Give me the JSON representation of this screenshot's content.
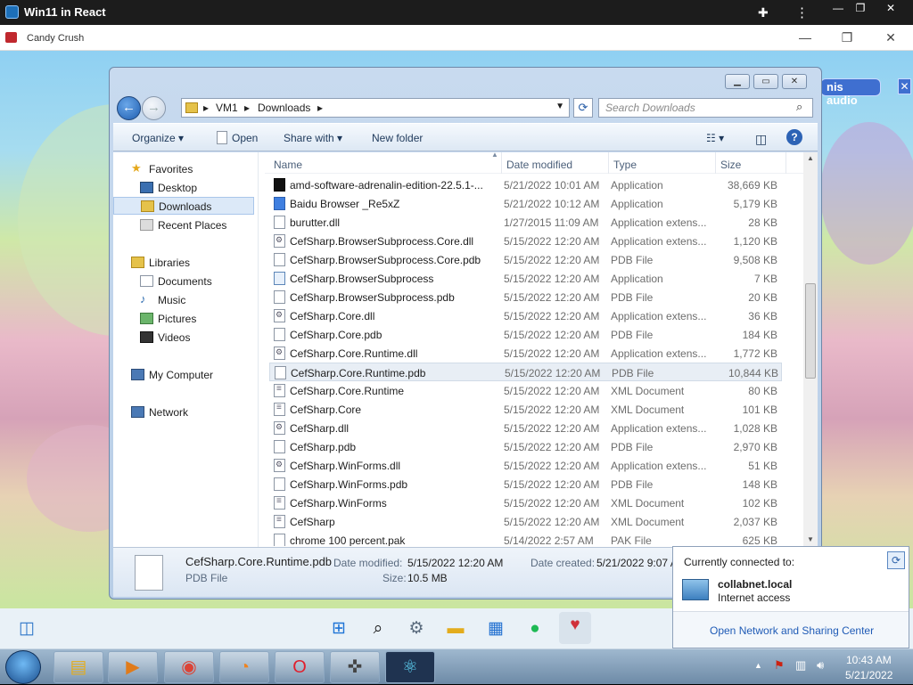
{
  "browser": {
    "title": "Win11 in React"
  },
  "game_window": {
    "title": "Candy Crush",
    "audio_badge": "nis audio"
  },
  "explorer": {
    "breadcrumb": [
      "VM1",
      "Downloads"
    ],
    "search_placeholder": "Search Downloads",
    "commands": {
      "organize": "Organize",
      "open": "Open",
      "share_with": "Share with",
      "new_folder": "New folder"
    },
    "nav": {
      "favorites": "Favorites",
      "desktop": "Desktop",
      "downloads": "Downloads",
      "recent_places": "Recent Places",
      "libraries": "Libraries",
      "documents": "Documents",
      "music": "Music",
      "pictures": "Pictures",
      "videos": "Videos",
      "my_computer": "My Computer",
      "network": "Network"
    },
    "columns": {
      "name": "Name",
      "date": "Date modified",
      "type": "Type",
      "size": "Size"
    },
    "files": [
      {
        "name": "amd-software-adrenalin-edition-22.5.1-...",
        "date": "5/21/2022 10:01 AM",
        "type": "Application",
        "size": "38,669 KB",
        "icon": "amd"
      },
      {
        "name": "Baidu Browser _Re5xZ",
        "date": "5/21/2022 10:12 AM",
        "type": "Application",
        "size": "5,179 KB",
        "icon": "baidu"
      },
      {
        "name": "burutter.dll",
        "date": "1/27/2015 11:09 AM",
        "type": "Application extens...",
        "size": "28 KB",
        "icon": "file"
      },
      {
        "name": "CefSharp.BrowserSubprocess.Core.dll",
        "date": "5/15/2022 12:20 AM",
        "type": "Application extens...",
        "size": "1,120 KB",
        "icon": "dll"
      },
      {
        "name": "CefSharp.BrowserSubprocess.Core.pdb",
        "date": "5/15/2022 12:20 AM",
        "type": "PDB File",
        "size": "9,508 KB",
        "icon": "file"
      },
      {
        "name": "CefSharp.BrowserSubprocess",
        "date": "5/15/2022 12:20 AM",
        "type": "Application",
        "size": "7 KB",
        "icon": "app"
      },
      {
        "name": "CefSharp.BrowserSubprocess.pdb",
        "date": "5/15/2022 12:20 AM",
        "type": "PDB File",
        "size": "20 KB",
        "icon": "file"
      },
      {
        "name": "CefSharp.Core.dll",
        "date": "5/15/2022 12:20 AM",
        "type": "Application extens...",
        "size": "36 KB",
        "icon": "dll"
      },
      {
        "name": "CefSharp.Core.pdb",
        "date": "5/15/2022 12:20 AM",
        "type": "PDB File",
        "size": "184 KB",
        "icon": "file"
      },
      {
        "name": "CefSharp.Core.Runtime.dll",
        "date": "5/15/2022 12:20 AM",
        "type": "Application extens...",
        "size": "1,772 KB",
        "icon": "dll"
      },
      {
        "name": "CefSharp.Core.Runtime.pdb",
        "date": "5/15/2022 12:20 AM",
        "type": "PDB File",
        "size": "10,844 KB",
        "icon": "file",
        "selected": true
      },
      {
        "name": "CefSharp.Core.Runtime",
        "date": "5/15/2022 12:20 AM",
        "type": "XML Document",
        "size": "80 KB",
        "icon": "xml"
      },
      {
        "name": "CefSharp.Core",
        "date": "5/15/2022 12:20 AM",
        "type": "XML Document",
        "size": "101 KB",
        "icon": "xml"
      },
      {
        "name": "CefSharp.dll",
        "date": "5/15/2022 12:20 AM",
        "type": "Application extens...",
        "size": "1,028 KB",
        "icon": "dll"
      },
      {
        "name": "CefSharp.pdb",
        "date": "5/15/2022 12:20 AM",
        "type": "PDB File",
        "size": "2,970 KB",
        "icon": "file"
      },
      {
        "name": "CefSharp.WinForms.dll",
        "date": "5/15/2022 12:20 AM",
        "type": "Application extens...",
        "size": "51 KB",
        "icon": "dll"
      },
      {
        "name": "CefSharp.WinForms.pdb",
        "date": "5/15/2022 12:20 AM",
        "type": "PDB File",
        "size": "148 KB",
        "icon": "file"
      },
      {
        "name": "CefSharp.WinForms",
        "date": "5/15/2022 12:20 AM",
        "type": "XML Document",
        "size": "102 KB",
        "icon": "xml"
      },
      {
        "name": "CefSharp",
        "date": "5/15/2022 12:20 AM",
        "type": "XML Document",
        "size": "2,037 KB",
        "icon": "xml"
      },
      {
        "name": "chrome 100 percent.pak",
        "date": "5/14/2022 2:57 AM",
        "type": "PAK File",
        "size": "625 KB",
        "icon": "file"
      }
    ],
    "details": {
      "name": "CefSharp.Core.Runtime.pdb",
      "type": "PDB File",
      "modified_label": "Date modified:",
      "modified": "5/15/2022 12:20 AM",
      "created_label": "Date created:",
      "created": "5/21/2022 9:07 A",
      "size_label": "Size:",
      "size": "10.5 MB"
    }
  },
  "network_popup": {
    "header": "Currently connected to:",
    "network_name": "collabnet.local",
    "status": "Internet access",
    "link": "Open Network and Sharing Center"
  },
  "tray": {
    "time": "10:43 AM",
    "date": "5/21/2022"
  }
}
